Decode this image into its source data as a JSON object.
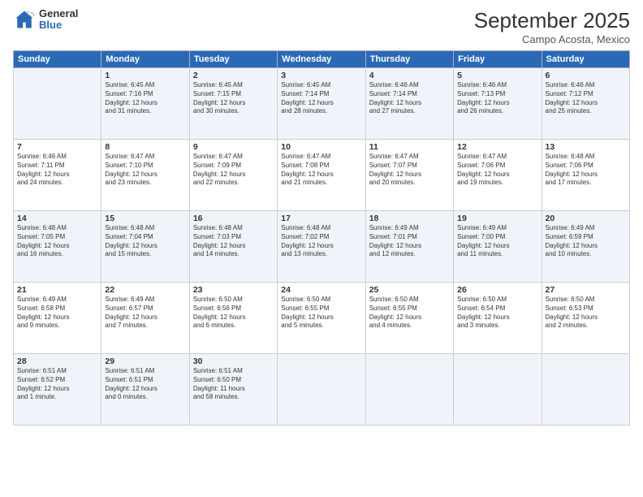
{
  "header": {
    "logo_general": "General",
    "logo_blue": "Blue",
    "month_title": "September 2025",
    "location": "Campo Acosta, Mexico"
  },
  "weekdays": [
    "Sunday",
    "Monday",
    "Tuesday",
    "Wednesday",
    "Thursday",
    "Friday",
    "Saturday"
  ],
  "weeks": [
    [
      {
        "day": "",
        "info": ""
      },
      {
        "day": "1",
        "info": "Sunrise: 6:45 AM\nSunset: 7:16 PM\nDaylight: 12 hours\nand 31 minutes."
      },
      {
        "day": "2",
        "info": "Sunrise: 6:45 AM\nSunset: 7:15 PM\nDaylight: 12 hours\nand 30 minutes."
      },
      {
        "day": "3",
        "info": "Sunrise: 6:45 AM\nSunset: 7:14 PM\nDaylight: 12 hours\nand 28 minutes."
      },
      {
        "day": "4",
        "info": "Sunrise: 6:46 AM\nSunset: 7:14 PM\nDaylight: 12 hours\nand 27 minutes."
      },
      {
        "day": "5",
        "info": "Sunrise: 6:46 AM\nSunset: 7:13 PM\nDaylight: 12 hours\nand 26 minutes."
      },
      {
        "day": "6",
        "info": "Sunrise: 6:46 AM\nSunset: 7:12 PM\nDaylight: 12 hours\nand 25 minutes."
      }
    ],
    [
      {
        "day": "7",
        "info": "Sunrise: 6:46 AM\nSunset: 7:11 PM\nDaylight: 12 hours\nand 24 minutes."
      },
      {
        "day": "8",
        "info": "Sunrise: 6:47 AM\nSunset: 7:10 PM\nDaylight: 12 hours\nand 23 minutes."
      },
      {
        "day": "9",
        "info": "Sunrise: 6:47 AM\nSunset: 7:09 PM\nDaylight: 12 hours\nand 22 minutes."
      },
      {
        "day": "10",
        "info": "Sunrise: 6:47 AM\nSunset: 7:08 PM\nDaylight: 12 hours\nand 21 minutes."
      },
      {
        "day": "11",
        "info": "Sunrise: 6:47 AM\nSunset: 7:07 PM\nDaylight: 12 hours\nand 20 minutes."
      },
      {
        "day": "12",
        "info": "Sunrise: 6:47 AM\nSunset: 7:06 PM\nDaylight: 12 hours\nand 19 minutes."
      },
      {
        "day": "13",
        "info": "Sunrise: 6:48 AM\nSunset: 7:06 PM\nDaylight: 12 hours\nand 17 minutes."
      }
    ],
    [
      {
        "day": "14",
        "info": "Sunrise: 6:48 AM\nSunset: 7:05 PM\nDaylight: 12 hours\nand 16 minutes."
      },
      {
        "day": "15",
        "info": "Sunrise: 6:48 AM\nSunset: 7:04 PM\nDaylight: 12 hours\nand 15 minutes."
      },
      {
        "day": "16",
        "info": "Sunrise: 6:48 AM\nSunset: 7:03 PM\nDaylight: 12 hours\nand 14 minutes."
      },
      {
        "day": "17",
        "info": "Sunrise: 6:48 AM\nSunset: 7:02 PM\nDaylight: 12 hours\nand 13 minutes."
      },
      {
        "day": "18",
        "info": "Sunrise: 6:49 AM\nSunset: 7:01 PM\nDaylight: 12 hours\nand 12 minutes."
      },
      {
        "day": "19",
        "info": "Sunrise: 6:49 AM\nSunset: 7:00 PM\nDaylight: 12 hours\nand 11 minutes."
      },
      {
        "day": "20",
        "info": "Sunrise: 6:49 AM\nSunset: 6:59 PM\nDaylight: 12 hours\nand 10 minutes."
      }
    ],
    [
      {
        "day": "21",
        "info": "Sunrise: 6:49 AM\nSunset: 6:58 PM\nDaylight: 12 hours\nand 9 minutes."
      },
      {
        "day": "22",
        "info": "Sunrise: 6:49 AM\nSunset: 6:57 PM\nDaylight: 12 hours\nand 7 minutes."
      },
      {
        "day": "23",
        "info": "Sunrise: 6:50 AM\nSunset: 6:56 PM\nDaylight: 12 hours\nand 6 minutes."
      },
      {
        "day": "24",
        "info": "Sunrise: 6:50 AM\nSunset: 6:55 PM\nDaylight: 12 hours\nand 5 minutes."
      },
      {
        "day": "25",
        "info": "Sunrise: 6:50 AM\nSunset: 6:55 PM\nDaylight: 12 hours\nand 4 minutes."
      },
      {
        "day": "26",
        "info": "Sunrise: 6:50 AM\nSunset: 6:54 PM\nDaylight: 12 hours\nand 3 minutes."
      },
      {
        "day": "27",
        "info": "Sunrise: 6:50 AM\nSunset: 6:53 PM\nDaylight: 12 hours\nand 2 minutes."
      }
    ],
    [
      {
        "day": "28",
        "info": "Sunrise: 6:51 AM\nSunset: 6:52 PM\nDaylight: 12 hours\nand 1 minute."
      },
      {
        "day": "29",
        "info": "Sunrise: 6:51 AM\nSunset: 6:51 PM\nDaylight: 12 hours\nand 0 minutes."
      },
      {
        "day": "30",
        "info": "Sunrise: 6:51 AM\nSunset: 6:50 PM\nDaylight: 11 hours\nand 58 minutes."
      },
      {
        "day": "",
        "info": ""
      },
      {
        "day": "",
        "info": ""
      },
      {
        "day": "",
        "info": ""
      },
      {
        "day": "",
        "info": ""
      }
    ]
  ]
}
